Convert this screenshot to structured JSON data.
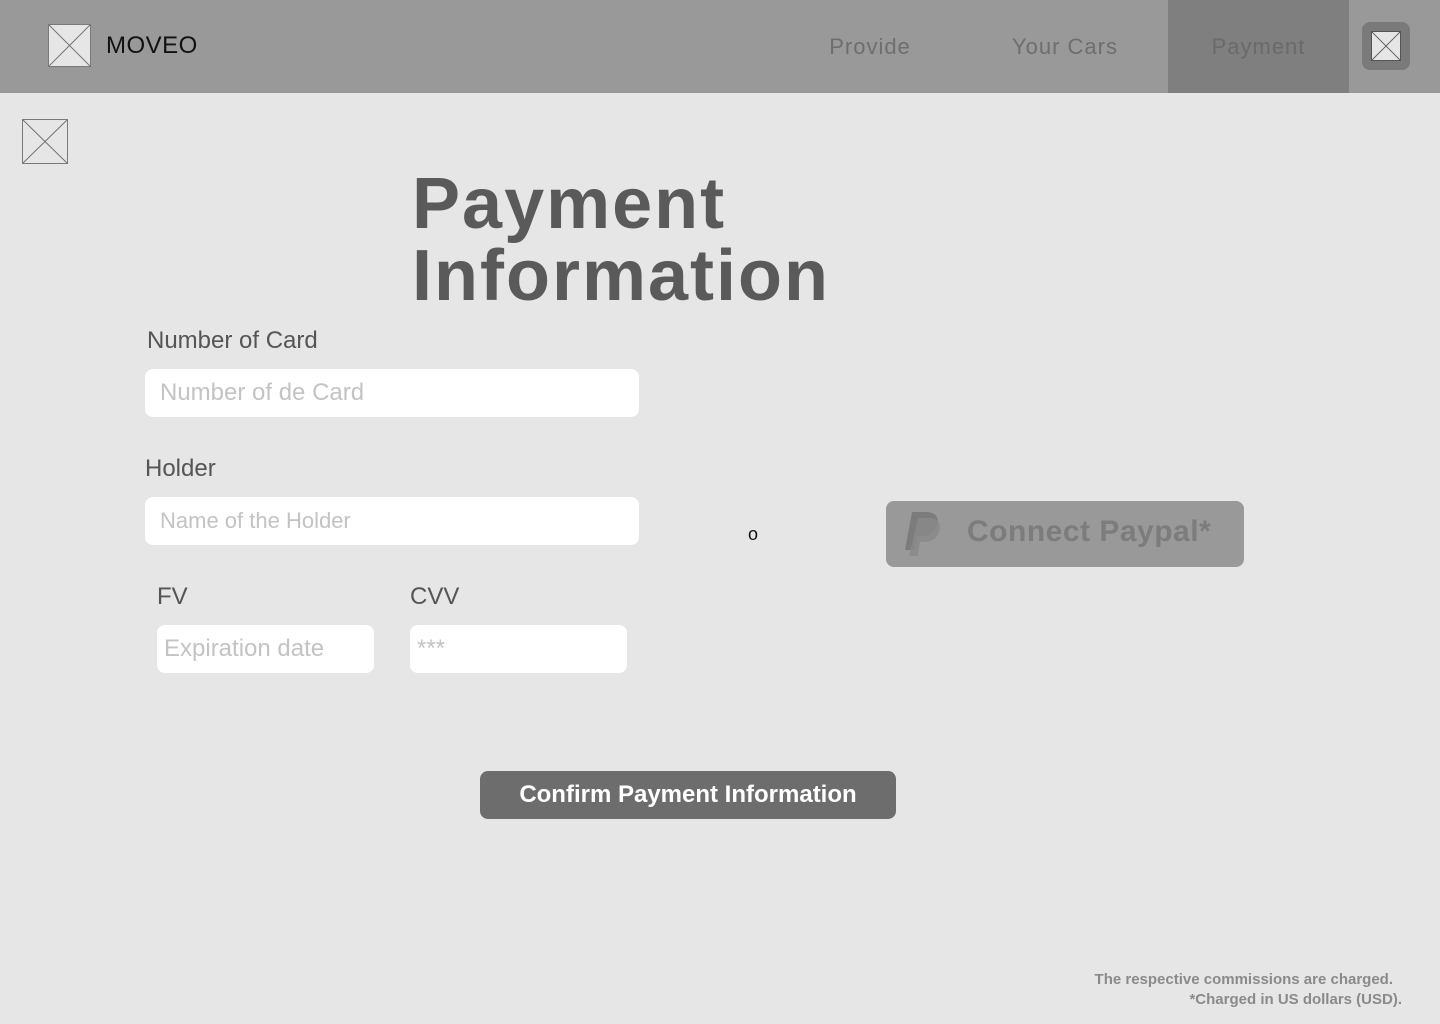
{
  "header": {
    "brand": "MOVEO",
    "nav": {
      "provide": "Provide",
      "your_cars": "Your Cars",
      "payment": "Payment"
    },
    "active_nav": "Payment"
  },
  "title": {
    "line1": "Payment",
    "line2": "Information"
  },
  "form": {
    "card_number": {
      "label": "Number of Card",
      "placeholder": "Number of de Card",
      "value": ""
    },
    "holder": {
      "label": "Holder",
      "placeholder": "Name of the Holder",
      "value": ""
    },
    "expiration": {
      "label": "FV",
      "placeholder": "Expiration date",
      "value": ""
    },
    "cvv": {
      "label": "CVV",
      "placeholder": "***",
      "value": ""
    }
  },
  "or_separator": "o",
  "paypal": {
    "label": "Connect Paypal*",
    "icon": "paypal-icon"
  },
  "confirm_button": "Confirm Payment Information",
  "footnotes": {
    "line1": "The respective commissions are charged.",
    "line2": "*Charged in US dollars (USD)."
  },
  "colors": {
    "background": "#e6e6e6",
    "topbar": "#999999",
    "active_tab": "#7f7f7f",
    "primary_button": "#6d6d6d",
    "paypal_button": "#999999"
  }
}
